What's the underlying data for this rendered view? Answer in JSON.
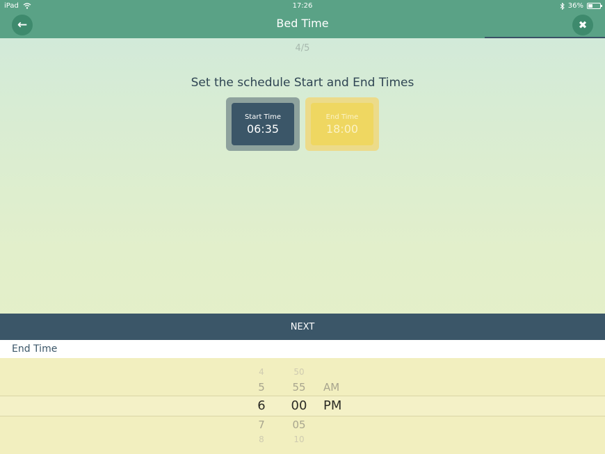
{
  "status": {
    "device": "iPad",
    "time": "17:26",
    "battery": "36%"
  },
  "header": {
    "title": "Bed Time",
    "back_icon": "←",
    "close_icon": "✖"
  },
  "step": "4/5",
  "heading": "Set the schedule Start and End Times",
  "start": {
    "label": "Start Time",
    "value": "06:35"
  },
  "end": {
    "label": "End Time",
    "value": "18:00"
  },
  "next_label": "NEXT",
  "picker": {
    "label": "End Time",
    "hours": [
      "4",
      "5",
      "6",
      "7",
      "8"
    ],
    "minutes": [
      "50",
      "55",
      "00",
      "05",
      "10"
    ],
    "ampm": [
      "AM",
      "PM"
    ]
  },
  "colors": {
    "header": "#5aa286",
    "dark": "#3b5668",
    "accent_yellow": "#efd761"
  }
}
